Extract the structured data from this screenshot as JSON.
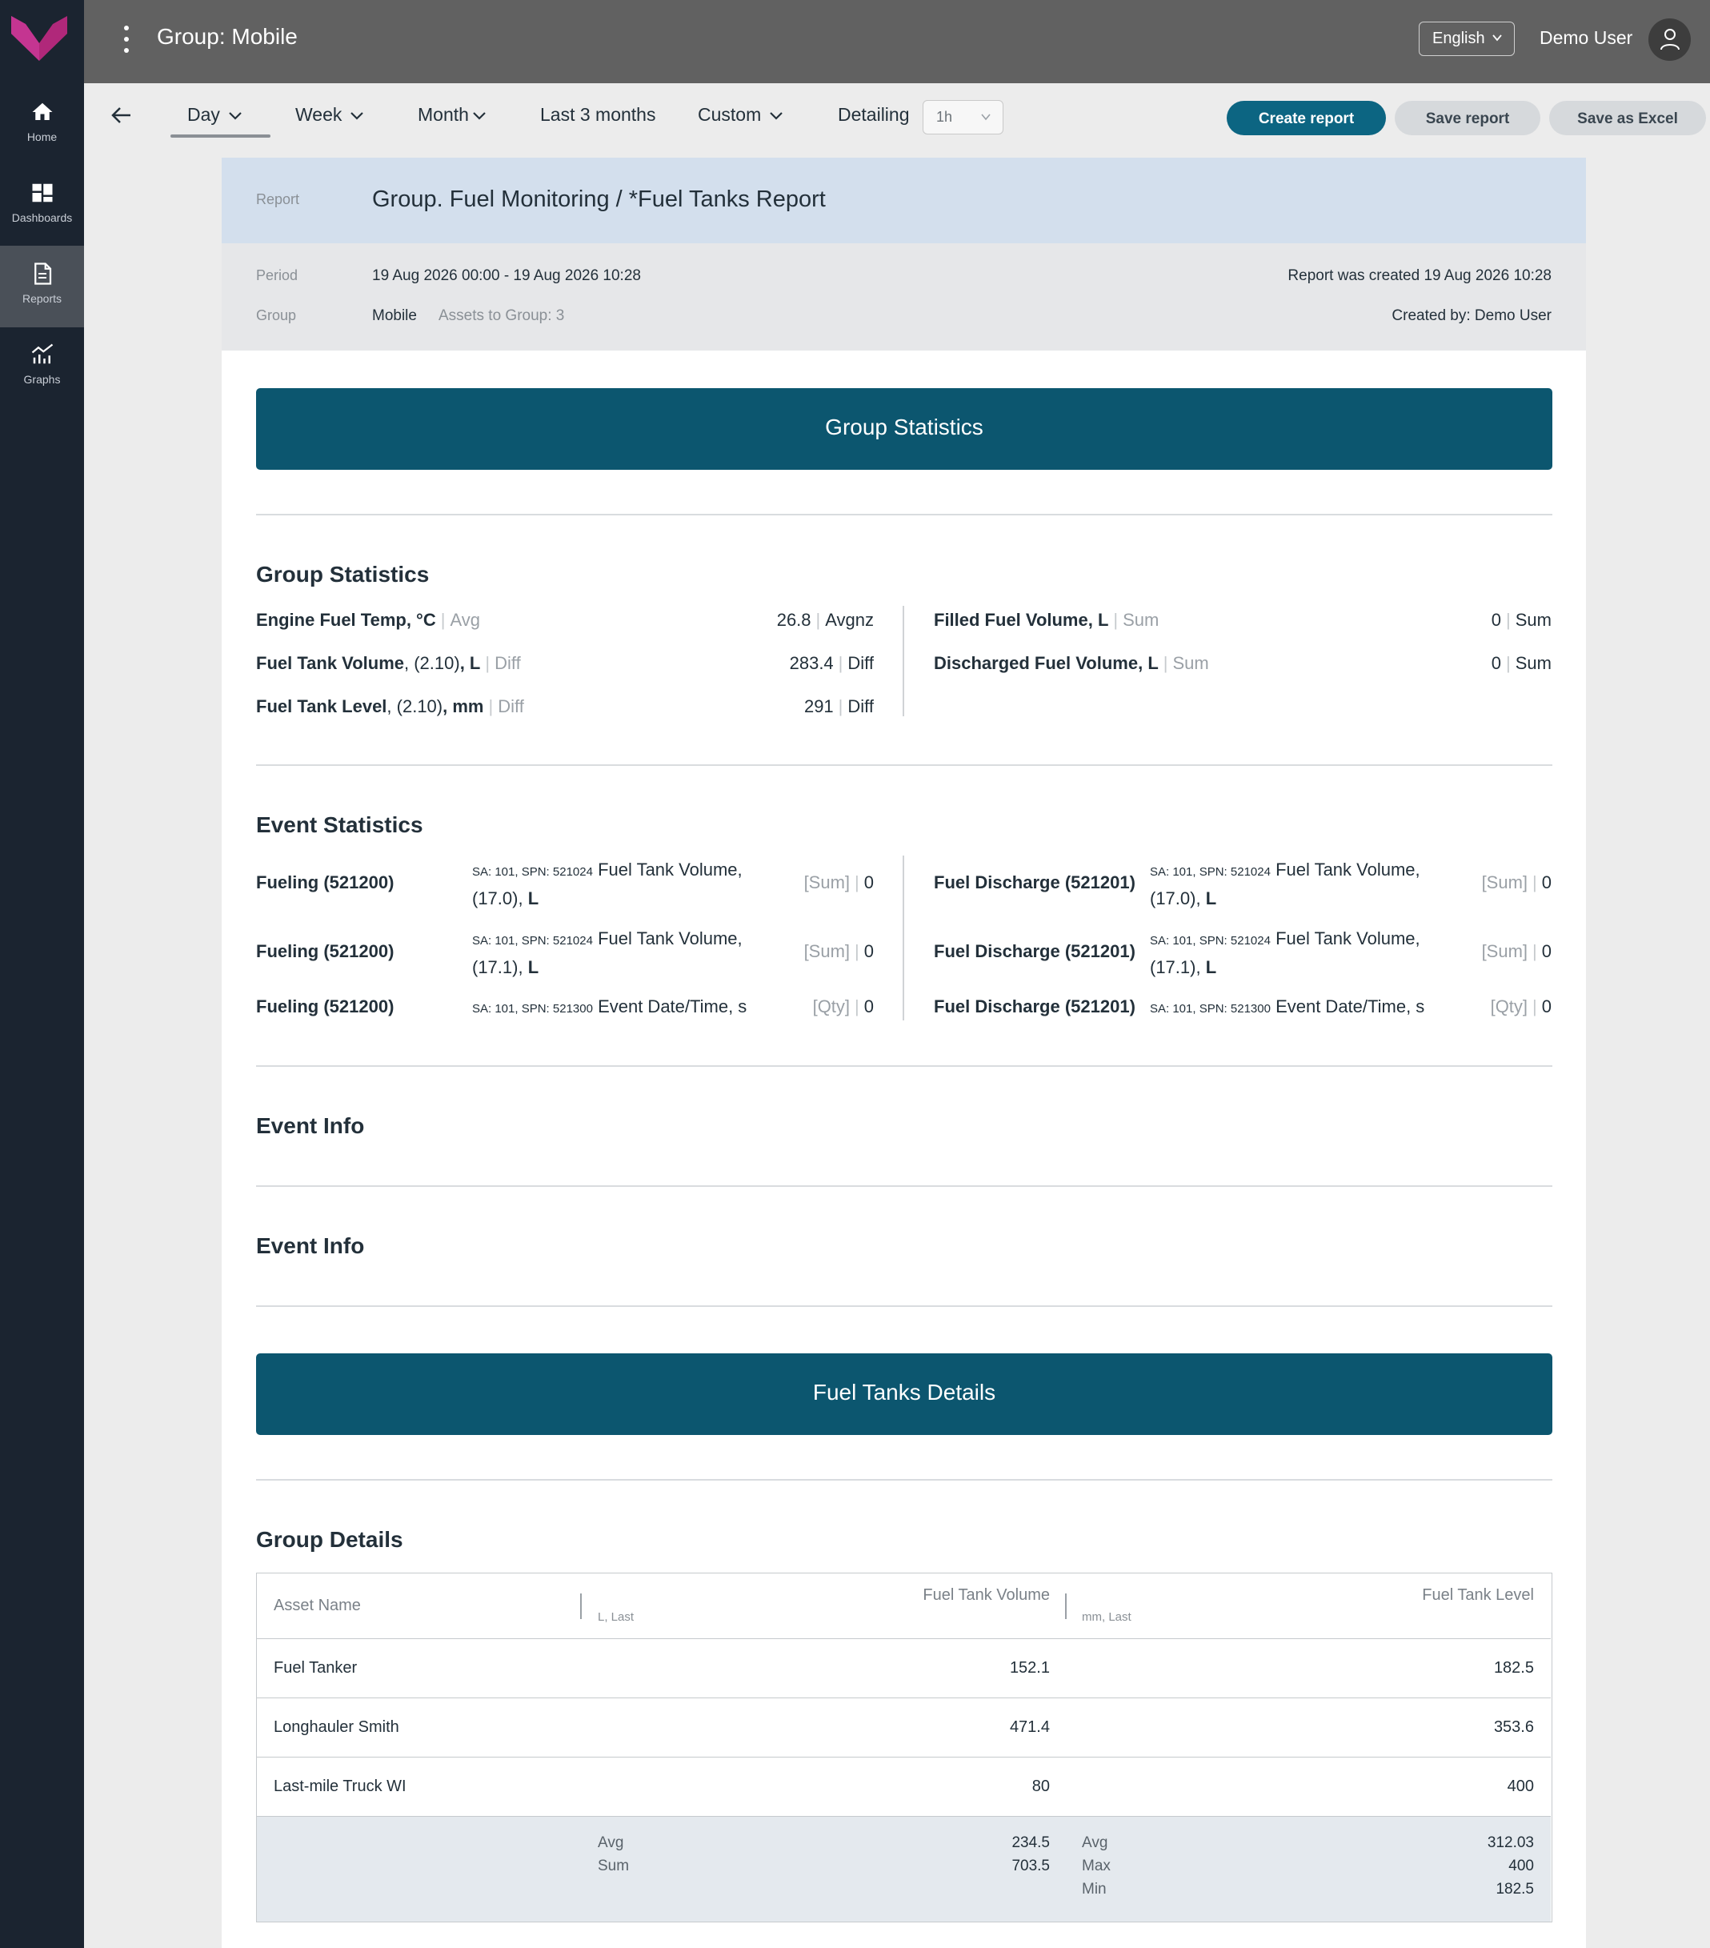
{
  "sidebar": {
    "items": [
      {
        "label": "Home",
        "icon": "home-icon"
      },
      {
        "label": "Dashboards",
        "icon": "dashboards-icon"
      },
      {
        "label": "Reports",
        "icon": "reports-icon",
        "active": true
      },
      {
        "label": "Graphs",
        "icon": "graphs-icon"
      }
    ]
  },
  "topbar": {
    "title": "Group: Mobile",
    "language": "English",
    "user_name": "Demo User"
  },
  "toolbar": {
    "tabs": [
      "Day",
      "Week",
      "Month",
      "Last 3 months",
      "Custom"
    ],
    "active_tab": "Day",
    "detailing_label": "Detailing",
    "detailing_value": "1h",
    "create_report": "Create report",
    "save_report": "Save report",
    "save_excel": "Save as Excel"
  },
  "report": {
    "label": "Report",
    "title": "Group. Fuel Monitoring / *Fuel Tanks Report",
    "period_label": "Period",
    "period_value": "19 Aug 2026 00:00 - 19 Aug 2026 10:28",
    "group_label": "Group",
    "group_value": "Mobile",
    "assets_to_group": "Assets to Group: 3",
    "created_at": "Report was created 19 Aug 2026 10:28",
    "created_by": "Created by: Demo User"
  },
  "group_statistics": {
    "banner": "Group Statistics",
    "title": "Group Statistics",
    "left": [
      {
        "name": "Engine Fuel Temp, °C",
        "name_a": "",
        "name_b": "",
        "agg": "Avg",
        "value": "26.8",
        "value_agg": "Avgnz"
      },
      {
        "name": "Fuel Tank Volume",
        "name_a": ", (2.10)",
        "name_b": ", L",
        "agg": "Diff",
        "value": "283.4",
        "value_agg": "Diff"
      },
      {
        "name": "Fuel Tank Level",
        "name_a": ", (2.10)",
        "name_b": ", mm",
        "agg": "Diff",
        "value": "291",
        "value_agg": "Diff"
      }
    ],
    "right": [
      {
        "name": "Filled Fuel Volume, L",
        "agg": "Sum",
        "value": "0",
        "value_agg": "Sum"
      },
      {
        "name": "Discharged Fuel Volume, L",
        "agg": "Sum",
        "value": "0",
        "value_agg": "Sum"
      }
    ]
  },
  "event_statistics": {
    "title": "Event Statistics",
    "left": [
      {
        "event": "Fueling (521200)",
        "sa": "SA: 101, SPN: 521024",
        "param": "Fuel Tank Volume,",
        "param2": "(17.0),",
        "unit": "L",
        "agg": "[Sum]",
        "value": "0"
      },
      {
        "event": "Fueling (521200)",
        "sa": "SA: 101, SPN: 521024",
        "param": "Fuel Tank Volume,",
        "param2": "(17.1),",
        "unit": "L",
        "agg": "[Sum]",
        "value": "0"
      },
      {
        "event": "Fueling (521200)",
        "sa": "SA: 101, SPN: 521300",
        "param": "Event Date/Time, s",
        "param2": "",
        "unit": "",
        "agg": "[Qty]",
        "value": "0"
      }
    ],
    "right": [
      {
        "event": "Fuel Discharge (521201)",
        "sa": "SA: 101, SPN: 521024",
        "param": "Fuel Tank Volume,",
        "param2": "(17.0),",
        "unit": "L",
        "agg": "[Sum]",
        "value": "0"
      },
      {
        "event": "Fuel Discharge (521201)",
        "sa": "SA: 101, SPN: 521024",
        "param": "Fuel Tank Volume,",
        "param2": "(17.1),",
        "unit": "L",
        "agg": "[Sum]",
        "value": "0"
      },
      {
        "event": "Fuel Discharge (521201)",
        "sa": "SA: 101, SPN: 521300",
        "param": "Event Date/Time, s",
        "param2": "",
        "unit": "",
        "agg": "[Qty]",
        "value": "0"
      }
    ]
  },
  "event_info": [
    "Event Info",
    "Event Info"
  ],
  "fuel_tanks": {
    "banner": "Fuel Tanks Details",
    "title": "Group Details",
    "table": {
      "headers": {
        "asset": "Asset Name",
        "col1": "Fuel Tank Volume",
        "col1_sub": "L, Last",
        "col2": "Fuel Tank Level",
        "col2_sub": "mm, Last"
      },
      "rows": [
        {
          "asset": "Fuel Tanker",
          "volume": "152.1",
          "level": "182.5"
        },
        {
          "asset": "Longhauler Smith",
          "volume": "471.4",
          "level": "353.6"
        },
        {
          "asset": "Last-mile Truck WI",
          "volume": "80",
          "level": "400"
        }
      ],
      "footer": {
        "col1": [
          {
            "label": "Avg",
            "value": "234.5"
          },
          {
            "label": "Sum",
            "value": "703.5"
          }
        ],
        "col2": [
          {
            "label": "Avg",
            "value": "312.03"
          },
          {
            "label": "Max",
            "value": "400"
          },
          {
            "label": "Min",
            "value": "182.5"
          }
        ]
      }
    }
  }
}
